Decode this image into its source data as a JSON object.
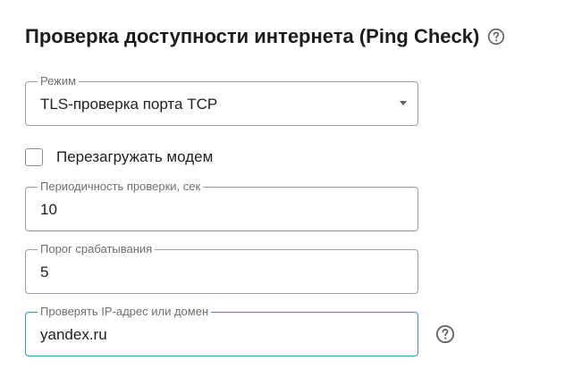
{
  "header": {
    "title": "Проверка доступности интернета (Ping Check)",
    "help_icon": "help-circle-icon"
  },
  "mode_select": {
    "label": "Режим",
    "value": "TLS-проверка порта TCP"
  },
  "reboot_modem": {
    "label": "Перезагружать модем",
    "checked": false
  },
  "interval_field": {
    "label": "Периодичность проверки, сек",
    "value": "10"
  },
  "threshold_field": {
    "label": "Порог срабатывания",
    "value": "5"
  },
  "target_field": {
    "label": "Проверять IP-адрес или домен",
    "value": "yandex.ru",
    "help_icon": "help-circle-icon"
  },
  "colors": {
    "focus_border": "#2c9bb6",
    "border": "#9e9e9e",
    "label": "#6f6f6f"
  }
}
